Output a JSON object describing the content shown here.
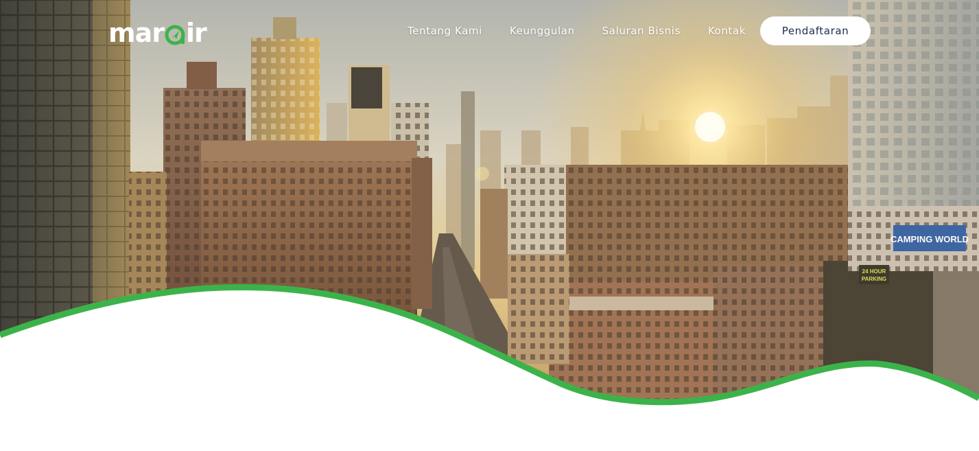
{
  "brand": {
    "logo_prefix": "mar",
    "logo_suffix": "ir",
    "accent_color": "#3cb34a"
  },
  "nav": {
    "items": [
      {
        "label": "Tentang Kami"
      },
      {
        "label": "Keunggulan"
      },
      {
        "label": "Saluran Bisnis"
      },
      {
        "label": "Kontak"
      }
    ],
    "cta_label": "Pendaftaran",
    "cta_text_color": "#1d2b4f"
  },
  "hero": {
    "billboard_text": "CAMPING WORLD",
    "parking_sign_line1": "24 HOUR",
    "parking_sign_line2": "PARKING",
    "wave_color": "#3cb34a"
  }
}
